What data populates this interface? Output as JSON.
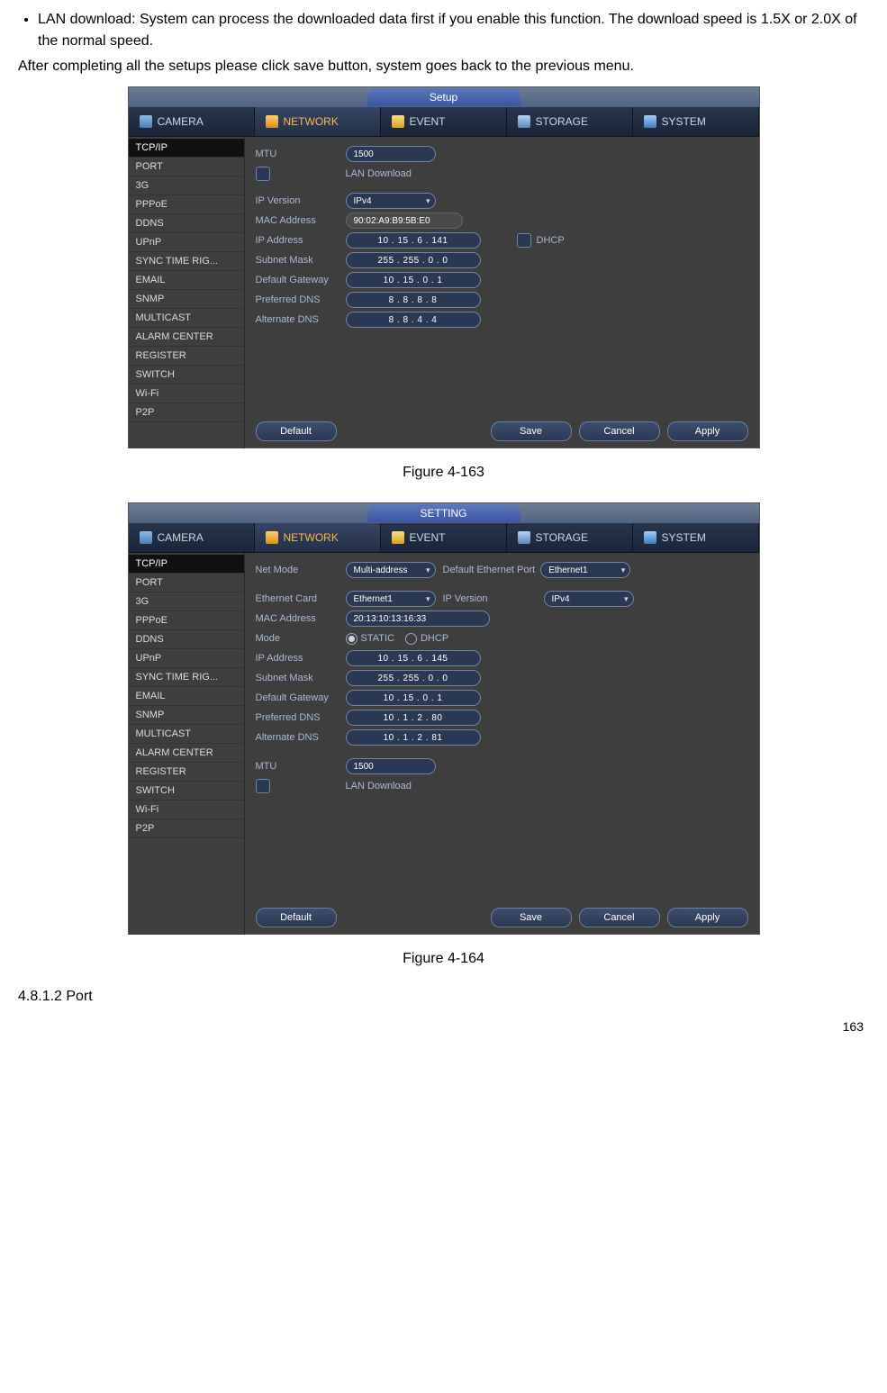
{
  "intro": {
    "bullet": "LAN download: System can process the downloaded data first if you enable this function. The download speed is 1.5X or 2.0X of the normal speed.",
    "after": "After completing all the setups please click save button, system goes back to the previous menu."
  },
  "tabs": {
    "camera": "CAMERA",
    "network": "NETWORK",
    "event": "EVENT",
    "storage": "STORAGE",
    "system": "SYSTEM"
  },
  "sidebar": {
    "items": [
      "TCP/IP",
      "PORT",
      "3G",
      "PPPoE",
      "DDNS",
      "UPnP",
      "SYNC TIME RIG...",
      "EMAIL",
      "SNMP",
      "MULTICAST",
      "ALARM CENTER",
      "REGISTER",
      "SWITCH",
      "Wi-Fi",
      "P2P"
    ]
  },
  "buttons": {
    "default": "Default",
    "save": "Save",
    "cancel": "Cancel",
    "apply": "Apply"
  },
  "fig163": {
    "title": "Setup",
    "mtu_label": "MTU",
    "mtu_value": "1500",
    "lan_dl": "LAN Download",
    "ipver_label": "IP Version",
    "ipver_value": "IPv4",
    "mac_label": "MAC Address",
    "mac_value": "90:02:A9:B9:5B:E0",
    "ip_label": "IP Address",
    "ip_value": "10  .   15  .    6   .  141",
    "dhcp": "DHCP",
    "sub_label": "Subnet Mask",
    "sub_value": "255 .  255 .    0   .    0",
    "gw_label": "Default Gateway",
    "gw_value": "10  .   15  .    0   .    1",
    "pdns_label": "Preferred DNS",
    "pdns_value": "8   .    8   .    8   .    8",
    "adns_label": "Alternate DNS",
    "adns_value": "8   .    8   .    4   .    4",
    "caption": "Figure 4-163"
  },
  "fig164": {
    "title": "SETTING",
    "netmode_label": "Net Mode",
    "netmode_value": "Multi-address",
    "defport_label": "Default Ethernet Port",
    "defport_value": "Ethernet1",
    "ethcard_label": "Ethernet Card",
    "ethcard_value": "Ethernet1",
    "ipver_label": "IP Version",
    "ipver_value": "IPv4",
    "mac_label": "MAC Address",
    "mac_value": "20:13:10:13:16:33",
    "mode_label": "Mode",
    "mode_static": "STATIC",
    "mode_dhcp": "DHCP",
    "ip_label": "IP Address",
    "ip_value": "10  .   15  .    6   .  145",
    "sub_label": "Subnet Mask",
    "sub_value": "255 .  255 .    0   .    0",
    "gw_label": "Default Gateway",
    "gw_value": "10  .   15  .    0   .    1",
    "pdns_label": "Preferred DNS",
    "pdns_value": "10  .    1   .    2   .   80",
    "adns_label": "Alternate DNS",
    "adns_value": "10  .    1   .    2   .   81",
    "mtu_label": "MTU",
    "mtu_value": "1500",
    "lan_dl": "LAN Download",
    "caption": "Figure 4-164"
  },
  "subheading": "4.8.1.2 Port",
  "pagenum": "163"
}
